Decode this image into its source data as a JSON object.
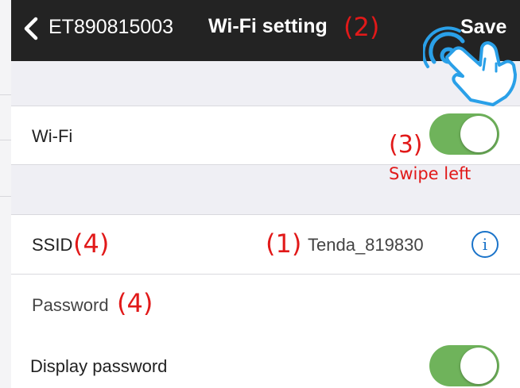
{
  "nav": {
    "device_name": "ET890815003",
    "title": "Wi-Fi setting",
    "title_annotation": "(2)",
    "save_label": "Save"
  },
  "wifi": {
    "label": "Wi-Fi",
    "enabled": true,
    "annotation": "(3)",
    "hint": "Swipe left"
  },
  "ssid": {
    "label": "SSID",
    "label_annotation": "(4)",
    "value_annotation": "(1)",
    "value": "Tenda_819830"
  },
  "password": {
    "label": "Password",
    "label_annotation": "(4)"
  },
  "display_password": {
    "label": "Display password",
    "enabled": true
  },
  "colors": {
    "nav_background": "#232323",
    "toggle_on": "#6fb35b",
    "annotation_red": "#e11919",
    "info_blue": "#1a73c9",
    "hand_cyan": "#2aa0e8"
  },
  "icons": [
    "chevron-left-icon",
    "info-icon",
    "tap-hand-icon"
  ]
}
